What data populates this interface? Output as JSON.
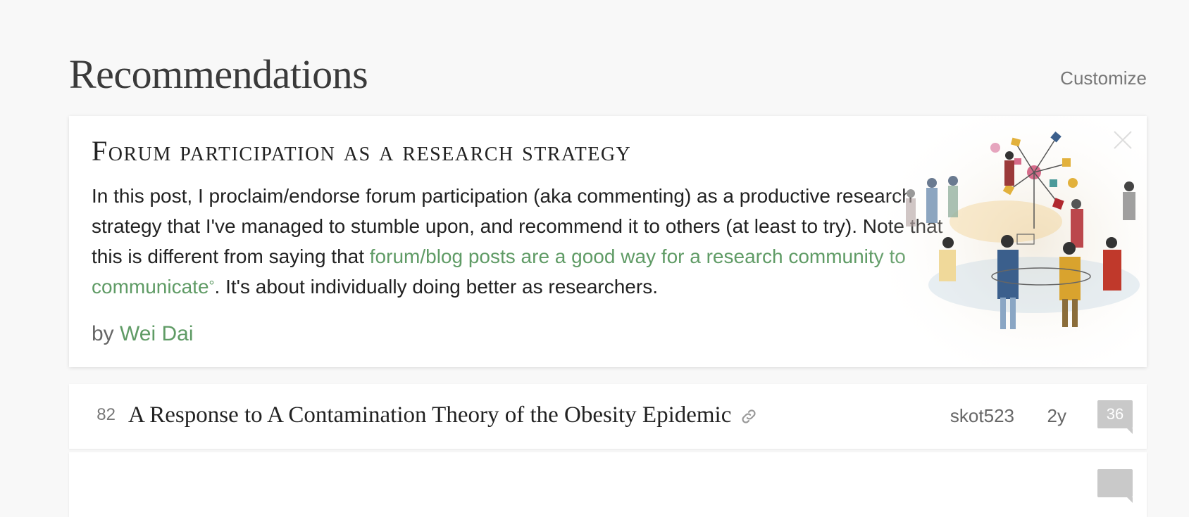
{
  "header": {
    "title": "Recommendations",
    "customize_label": "Customize"
  },
  "spotlight": {
    "title": "Forum participation as a research strategy",
    "desc_part1": "In this post, I proclaim/endorse forum participation (aka commenting) as a productive research strategy that I've managed to stumble upon, and recommend it to others (at least to try). Note that this is different from saying that ",
    "desc_link": "forum/blog posts are a good way for a research community to communicate",
    "desc_link_mark": "°",
    "desc_part2": ". It's about individually doing better as researchers.",
    "by_label": "by",
    "author": "Wei Dai",
    "image_icon": "watercolor-people-gathering-illustration",
    "close_icon": "close-icon"
  },
  "posts": [
    {
      "karma": "82",
      "title": "A Response to A Contamination Theory of the Obesity Epidemic",
      "author": "skot523",
      "age": "2y",
      "comments": "36",
      "link_icon": "link-icon"
    },
    {
      "karma": "",
      "title": "",
      "author": "",
      "age": "",
      "comments": ""
    }
  ],
  "colors": {
    "link_green": "#5f9b65",
    "background": "#f8f8f8",
    "comment_badge": "#c9c9c9"
  }
}
